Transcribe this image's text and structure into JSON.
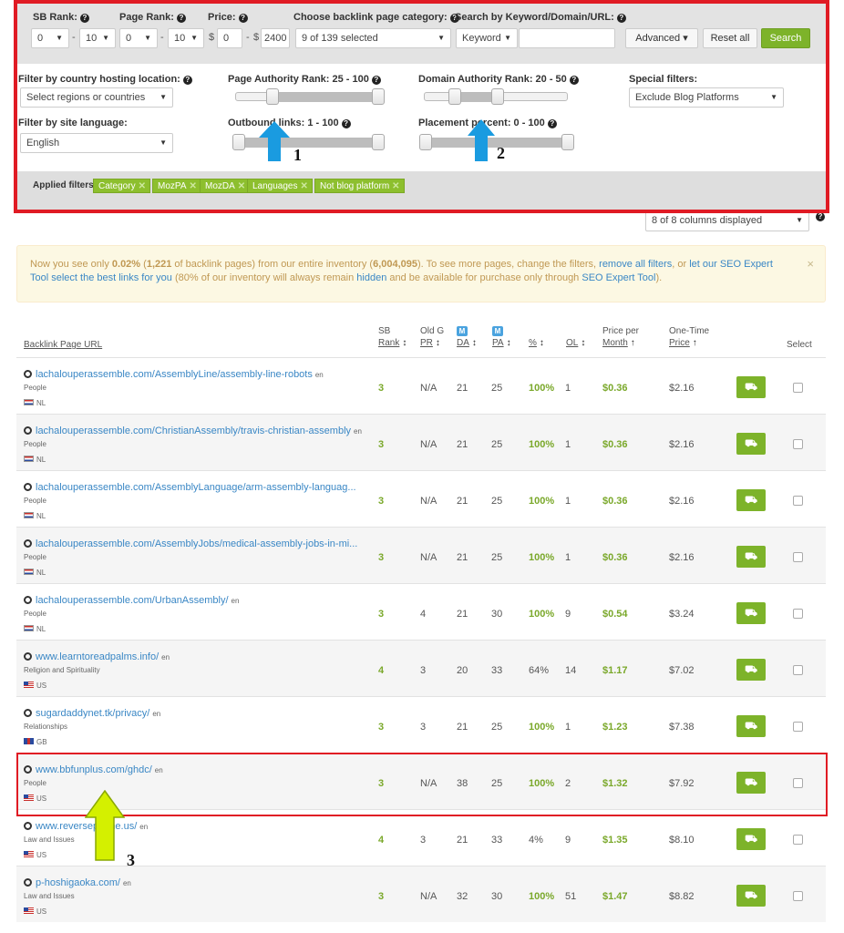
{
  "filters": {
    "sb_rank": {
      "label": "SB Rank:",
      "from": "0",
      "to": "10"
    },
    "page_rank": {
      "label": "Page Rank:",
      "from": "0",
      "to": "10"
    },
    "price": {
      "label": "Price:",
      "currency": "$",
      "from": "0",
      "to": "2400"
    },
    "range_sep": "-",
    "category": {
      "label": "Choose backlink page category:",
      "value": "9 of 139 selected"
    },
    "search": {
      "label": "Search by Keyword/Domain/URL:",
      "type_value": "Keyword",
      "query": ""
    },
    "advanced_label": "Advanced",
    "reset_label": "Reset all",
    "search_label": "Search",
    "country": {
      "label": "Filter by country hosting location:",
      "value": "Select regions or countries"
    },
    "language": {
      "label": "Filter by site language:",
      "value": "English"
    },
    "page_authority": {
      "label": "Page Authority Rank: 25 - 100",
      "min": 25,
      "max": 100
    },
    "domain_authority": {
      "label": "Domain Authority Rank: 20 - 50",
      "min": 20,
      "max": 50
    },
    "outbound_links": {
      "label": "Outbound links: 1 - 100",
      "min": 1,
      "max": 100
    },
    "placement": {
      "label": "Placement percent: 0 - 100",
      "min": 0,
      "max": 100
    },
    "special": {
      "label": "Special filters:",
      "value": "Exclude Blog Platforms"
    },
    "applied_label": "Applied filters:",
    "applied": [
      "Category",
      "MozPA",
      "MozDA",
      "Languages",
      "Not blog platform"
    ]
  },
  "columns_select": "8 of 8 columns displayed",
  "notice": {
    "t1": "Now you see only ",
    "pct": "0.02%",
    "t2": " (",
    "count": "1,221",
    "t3": " of backlink pages) from our entire inventory (",
    "total": "6,004,095",
    "t4": "). To see more pages, change the filters, ",
    "link1": "remove all filters",
    "t5": ", or ",
    "link2": "let our SEO Expert Tool select the best links for you",
    "t6": " (80% of our inventory will always remain ",
    "link3": "hidden",
    "t7": " and be available for purchase only through ",
    "link4": "SEO Expert Tool",
    "t8": ").",
    "close": "×"
  },
  "table": {
    "headers": {
      "url": "Backlink Page URL",
      "sb1": "SB",
      "sb2": "Rank",
      "pr1": "Old G",
      "pr2": "PR",
      "da1": "M",
      "da2": "DA",
      "pa1": "M",
      "pa2": "PA",
      "pct": "%",
      "ol": "OL",
      "ppm1": "Price per",
      "ppm2": "Month",
      "otp1": "One-Time",
      "otp2": "Price",
      "select": "Select"
    },
    "sort_icon": "↕",
    "sort_up_icon": "↑",
    "rows": [
      {
        "url": "lachalouperassemble.com/AssemblyLine/assembly-line-robots",
        "lang": "en",
        "cat": "People",
        "country": "NL",
        "flag": "nl",
        "sb": "3",
        "pr": "N/A",
        "da": "21",
        "pa": "25",
        "pct": "100%",
        "ol": "1",
        "ppm": "$0.36",
        "otp": "$2.16"
      },
      {
        "url": "lachalouperassemble.com/ChristianAssembly/travis-christian-assembly",
        "lang": "en",
        "cat": "People",
        "country": "NL",
        "flag": "nl",
        "sb": "3",
        "pr": "N/A",
        "da": "21",
        "pa": "25",
        "pct": "100%",
        "ol": "1",
        "ppm": "$0.36",
        "otp": "$2.16"
      },
      {
        "url": "lachalouperassemble.com/AssemblyLanguage/arm-assembly-languag...",
        "lang": "",
        "cat": "People",
        "country": "NL",
        "flag": "nl",
        "sb": "3",
        "pr": "N/A",
        "da": "21",
        "pa": "25",
        "pct": "100%",
        "ol": "1",
        "ppm": "$0.36",
        "otp": "$2.16"
      },
      {
        "url": "lachalouperassemble.com/AssemblyJobs/medical-assembly-jobs-in-mi...",
        "lang": "",
        "cat": "People",
        "country": "NL",
        "flag": "nl",
        "sb": "3",
        "pr": "N/A",
        "da": "21",
        "pa": "25",
        "pct": "100%",
        "ol": "1",
        "ppm": "$0.36",
        "otp": "$2.16"
      },
      {
        "url": "lachalouperassemble.com/UrbanAssembly/",
        "lang": "en",
        "cat": "People",
        "country": "NL",
        "flag": "nl",
        "sb": "3",
        "pr": "4",
        "da": "21",
        "pa": "30",
        "pct": "100%",
        "ol": "9",
        "ppm": "$0.54",
        "otp": "$3.24"
      },
      {
        "url": "www.learntoreadpalms.info/",
        "lang": "en",
        "cat": "Religion and Spirituality",
        "country": "US",
        "flag": "us",
        "sb": "4",
        "pr": "3",
        "da": "20",
        "pa": "33",
        "pct": "64%",
        "ol": "14",
        "ppm": "$1.17",
        "otp": "$7.02"
      },
      {
        "url": "sugardaddynet.tk/privacy/",
        "lang": "en",
        "cat": "Relationships",
        "country": "GB",
        "flag": "gb",
        "sb": "3",
        "pr": "3",
        "da": "21",
        "pa": "25",
        "pct": "100%",
        "ol": "1",
        "ppm": "$1.23",
        "otp": "$7.38"
      },
      {
        "url": "www.bbfunplus.com/ghdc/",
        "lang": "en",
        "cat": "People",
        "country": "US",
        "flag": "us",
        "sb": "3",
        "pr": "N/A",
        "da": "38",
        "pa": "25",
        "pct": "100%",
        "ol": "2",
        "ppm": "$1.32",
        "otp": "$7.92"
      },
      {
        "url": "www.reversephone.us/",
        "lang": "en",
        "cat": "Law and Issues",
        "country": "US",
        "flag": "us",
        "sb": "4",
        "pr": "3",
        "da": "21",
        "pa": "33",
        "pct": "4%",
        "ol": "9",
        "ppm": "$1.35",
        "otp": "$8.10"
      },
      {
        "url": "p-hoshigaoka.com/",
        "lang": "en",
        "cat": "Law and Issues",
        "country": "US",
        "flag": "us",
        "sb": "3",
        "pr": "N/A",
        "da": "32",
        "pa": "30",
        "pct": "100%",
        "ol": "51",
        "ppm": "$1.47",
        "otp": "$8.82"
      }
    ],
    "cart_icon": "⛟"
  },
  "annotations": {
    "n1": "1",
    "n2": "2",
    "n3": "3"
  },
  "colors": {
    "accent_green": "#7db32a",
    "link_blue": "#3a87c5",
    "highlight_red": "#e01b24",
    "arrow_blue": "#1a9be0",
    "arrow_yellow": "#d4f000"
  }
}
